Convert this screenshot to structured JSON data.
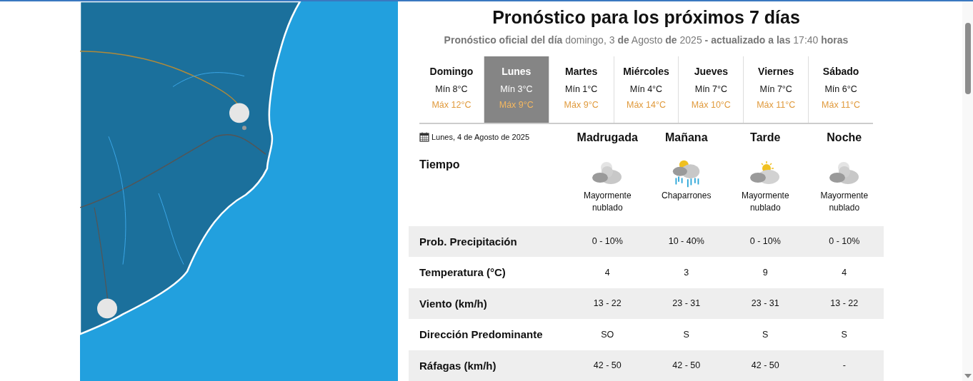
{
  "forecast": {
    "title": "Pronóstico para los próximos 7 días",
    "subtitle": "**Pronóstico oficial del día** domingo, 3 **de** Agosto **de** 2025 **- actualizado a las** 17:40 **horas**",
    "days": [
      {
        "name": "Domingo",
        "min": "Mín 8°C",
        "max": "Máx 12°C",
        "selected": false
      },
      {
        "name": "Lunes",
        "min": "Mín 3°C",
        "max": "Máx 9°C",
        "selected": true
      },
      {
        "name": "Martes",
        "min": "Mín 1°C",
        "max": "Máx 9°C",
        "selected": false
      },
      {
        "name": "Miércoles",
        "min": "Mín 4°C",
        "max": "Máx 14°C",
        "selected": false
      },
      {
        "name": "Jueves",
        "min": "Mín 7°C",
        "max": "Máx 10°C",
        "selected": false
      },
      {
        "name": "Viernes",
        "min": "Mín 7°C",
        "max": "Máx 11°C",
        "selected": false
      },
      {
        "name": "Sábado",
        "min": "Mín 6°C",
        "max": "Máx 11°C",
        "selected": false
      }
    ],
    "detail": {
      "date": "Lunes, 4 de Agosto de 2025",
      "weather_label": "Tiempo",
      "periods": [
        {
          "name": "Madrugada",
          "kind": "night-cloudy",
          "description": "Mayormente nublado"
        },
        {
          "name": "Mañana",
          "kind": "showers",
          "description": "Chaparrones"
        },
        {
          "name": "Tarde",
          "kind": "day-cloudy",
          "description": "Mayormente nublado"
        },
        {
          "name": "Noche",
          "kind": "night-cloudy",
          "description": "Mayormente nublado"
        }
      ],
      "rows": [
        {
          "label": "Prob. Precipitación",
          "values": [
            "0 - 10%",
            "10 - 40%",
            "0 - 10%",
            "0 - 10%"
          ]
        },
        {
          "label": "Temperatura (°C)",
          "values": [
            "4",
            "3",
            "9",
            "4"
          ]
        },
        {
          "label": "Viento (km/h)",
          "values": [
            "13 - 22",
            "23 - 31",
            "23 - 31",
            "13 - 22"
          ]
        },
        {
          "label": "Dirección Predominante",
          "values": [
            "SO",
            "S",
            "S",
            "S"
          ]
        },
        {
          "label": "Ráfagas (km/h)",
          "values": [
            "42 - 50",
            "42 - 50",
            "42 - 50",
            "-"
          ]
        }
      ]
    }
  }
}
